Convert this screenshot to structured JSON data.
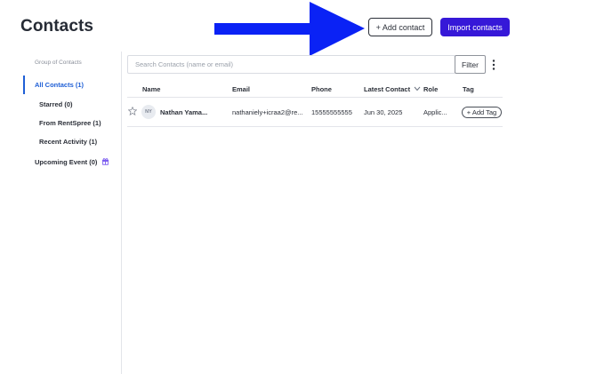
{
  "header": {
    "title": "Contacts",
    "add_contact_label": "+ Add contact",
    "import_contacts_label": "Import contacts"
  },
  "sidebar": {
    "group_label": "Group of Contacts",
    "items": [
      {
        "label": "All Contacts (1)",
        "active": true
      },
      {
        "label": "Starred (0)"
      },
      {
        "label": "From RentSpree (1)"
      },
      {
        "label": "Recent Activity (1)"
      },
      {
        "label": "Upcoming Event (0)",
        "icon": "gift-icon"
      }
    ]
  },
  "search": {
    "placeholder": "Search Contacts (name or email)",
    "filter_label": "Filter"
  },
  "table": {
    "columns": [
      "Name",
      "Email",
      "Phone",
      "Latest Contact",
      "Role",
      "Tag"
    ],
    "rows": [
      {
        "initials": "NY",
        "name": "Nathan Yama...",
        "email": "nathaniely+icraa2@re...",
        "phone": "15555555555",
        "latest_contact": "Jun 30, 2025",
        "role": "Applic...",
        "tag_label": "+ Add Tag"
      }
    ]
  },
  "colors": {
    "accent": "#1f5fd6",
    "primary_button": "#3618d8",
    "arrow": "#0a22f5"
  }
}
